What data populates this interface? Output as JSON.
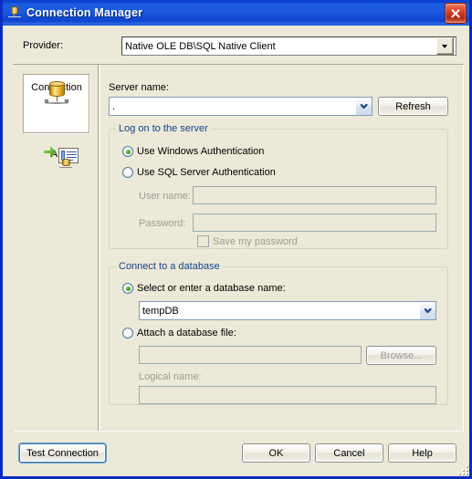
{
  "window": {
    "title": "Connection Manager",
    "icon": "database-icon",
    "close_label": "x"
  },
  "provider": {
    "label": "Provider:",
    "value": "Native OLE DB\\SQL Native Client"
  },
  "sidebar": {
    "items": [
      {
        "label": "Connection",
        "icon": "database-connection-icon",
        "selected": true
      },
      {
        "label": "All",
        "icon": "all-properties-icon",
        "selected": false
      }
    ]
  },
  "server": {
    "name_label": "Server name:",
    "name_value": ".",
    "refresh_label": "Refresh"
  },
  "logon": {
    "group_title": "Log on to the server",
    "windows_auth_label": "Use Windows Authentication",
    "sql_auth_label": "Use SQL Server Authentication",
    "username_label": "User name:",
    "username_value": "",
    "password_label": "Password:",
    "password_value": "",
    "save_password_label": "Save my password"
  },
  "database": {
    "group_title": "Connect to a database",
    "select_label": "Select or enter a database name:",
    "select_value": "tempDB",
    "attach_label": "Attach a database file:",
    "attach_value": "",
    "browse_label": "Browse...",
    "logical_label": "Logical name:",
    "logical_value": ""
  },
  "footer": {
    "test_label": "Test Connection",
    "ok_label": "OK",
    "cancel_label": "Cancel",
    "help_label": "Help"
  },
  "colors": {
    "titlebar_blue": "#1c59dd",
    "group_title_blue": "#15428b",
    "face": "#ece9d8",
    "close_red": "#c9321a",
    "radio_green": "#3f9b17"
  }
}
